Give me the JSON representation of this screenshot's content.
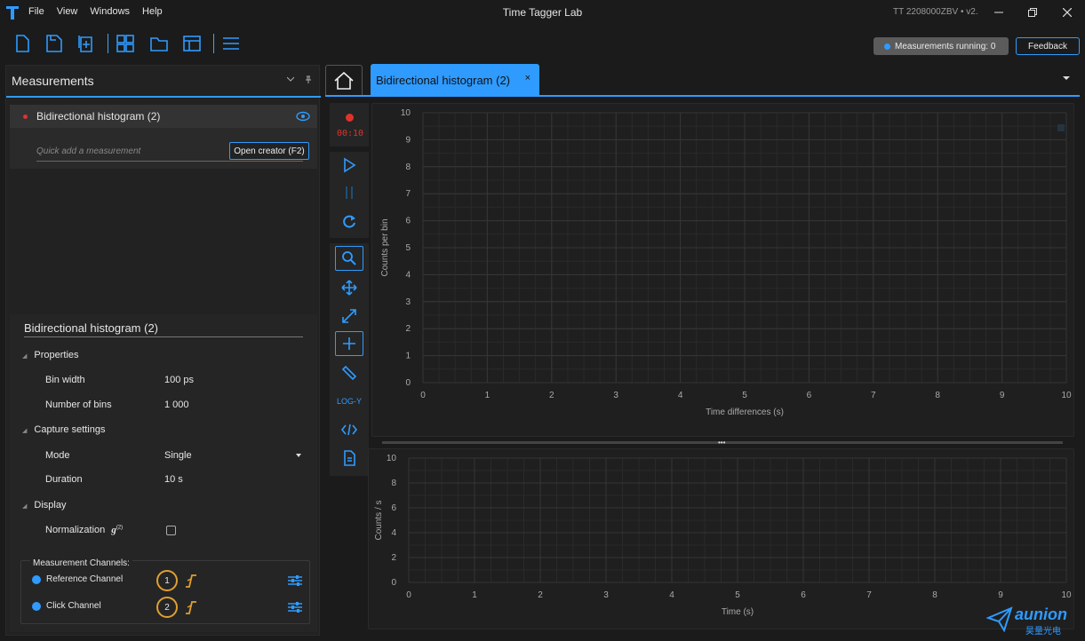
{
  "titlebar": {
    "menu": [
      "File",
      "View",
      "Windows",
      "Help"
    ],
    "app_title": "Time Tagger Lab",
    "device": "TT 2208000ZBV  •  v2."
  },
  "toolbar": {
    "running_label": "Measurements running: 0",
    "feedback_label": "Feedback"
  },
  "left_panel": {
    "title": "Measurements",
    "measurement_item": "Bidirectional histogram (2)",
    "quick_add_placeholder": "Quick add a measurement",
    "open_creator_label": "Open creator (F2)"
  },
  "properties": {
    "title": "Bidirectional histogram (2)",
    "sections": {
      "properties": "Properties",
      "capture": "Capture settings",
      "display": "Display"
    },
    "bin_width_label": "Bin width",
    "bin_width_value": "100 ps",
    "num_bins_label": "Number of bins",
    "num_bins_value": "1 000",
    "mode_label": "Mode",
    "mode_value": "Single",
    "duration_label": "Duration",
    "duration_value": "10 s",
    "normalization_label": "Normalization",
    "normalization_symbol": "g",
    "normalization_sup": "(2)",
    "normalization_checked": false,
    "channels_title": "Measurement Channels:",
    "channels": [
      {
        "name": "Reference Channel",
        "number": "1"
      },
      {
        "name": "Click Channel",
        "number": "2"
      }
    ]
  },
  "tabs": {
    "active": "Bidirectional histogram (2)",
    "close": "×"
  },
  "side_tools": {
    "record_time": "00:10",
    "log_y": "LOG-Y"
  },
  "colors": {
    "accent": "#2f9bff",
    "record": "#e0322b",
    "channel_ring": "#e0a030"
  },
  "chart_data": [
    {
      "type": "line",
      "title": "",
      "xlabel": "Time differences (s)",
      "ylabel": "Counts per bin",
      "xlim": [
        0,
        10
      ],
      "ylim": [
        0,
        10
      ],
      "x_ticks": [
        "0",
        "1",
        "2",
        "3",
        "4",
        "5",
        "6",
        "7",
        "8",
        "9",
        "10"
      ],
      "y_ticks": [
        "0",
        "1",
        "2",
        "3",
        "4",
        "5",
        "6",
        "7",
        "8",
        "9",
        "10"
      ],
      "grid": true,
      "series": []
    },
    {
      "type": "line",
      "title": "",
      "xlabel": "Time (s)",
      "ylabel": "Counts / s",
      "xlim": [
        0,
        10
      ],
      "ylim": [
        0,
        10
      ],
      "x_ticks": [
        "0",
        "1",
        "2",
        "3",
        "4",
        "5",
        "6",
        "7",
        "8",
        "9",
        "10"
      ],
      "y_ticks": [
        "0",
        "2",
        "4",
        "6",
        "8",
        "10"
      ],
      "grid": true,
      "series": []
    }
  ],
  "watermark": {
    "text": "aunion",
    "subtext": "昊量光电"
  }
}
